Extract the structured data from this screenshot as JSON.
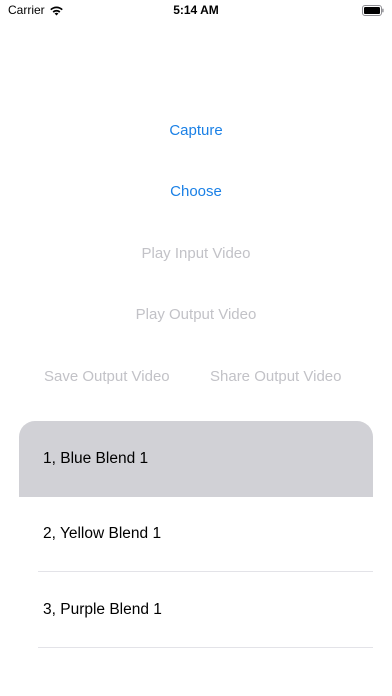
{
  "status_bar": {
    "carrier": "Carrier",
    "time": "5:14 AM",
    "icons": [
      "wifi-icon",
      "battery-icon"
    ]
  },
  "buttons": {
    "capture": "Capture",
    "choose": "Choose",
    "play_input": "Play Input Video",
    "play_output": "Play Output Video",
    "save_output": "Save Output Video",
    "share_output": "Share Output Video"
  },
  "colors": {
    "enabled": "#1a80e6",
    "disabled": "#c2c2c7",
    "selected_row": "#d1d1d6"
  },
  "list": {
    "items": [
      {
        "label": "1, Blue Blend 1",
        "selected": true
      },
      {
        "label": "2, Yellow Blend 1",
        "selected": false
      },
      {
        "label": "3, Purple Blend 1",
        "selected": false
      }
    ]
  }
}
